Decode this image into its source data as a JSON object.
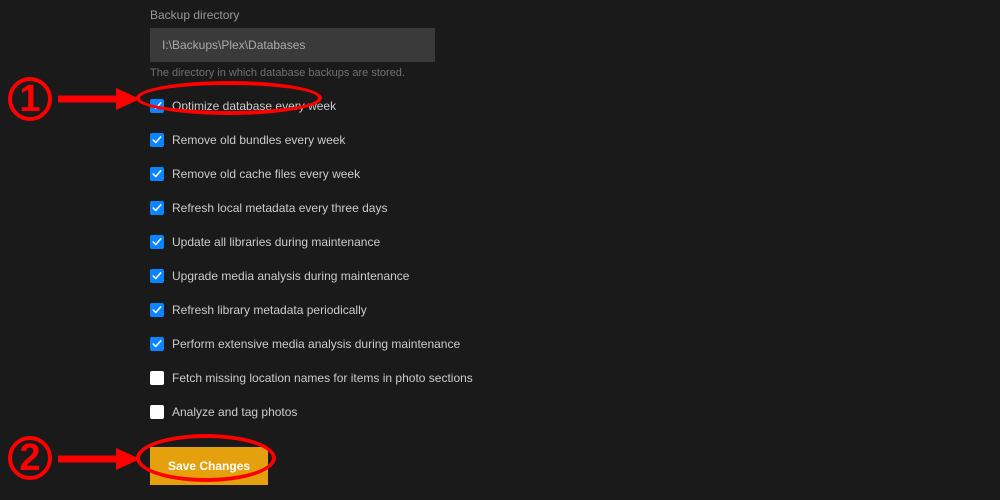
{
  "backup": {
    "label": "Backup directory",
    "value": "I:\\Backups\\Plex\\Databases",
    "help": "The directory in which database backups are stored."
  },
  "checkboxes": [
    {
      "label": "Optimize database every week",
      "checked": true
    },
    {
      "label": "Remove old bundles every week",
      "checked": true
    },
    {
      "label": "Remove old cache files every week",
      "checked": true
    },
    {
      "label": "Refresh local metadata every three days",
      "checked": true
    },
    {
      "label": "Update all libraries during maintenance",
      "checked": true
    },
    {
      "label": "Upgrade media analysis during maintenance",
      "checked": true
    },
    {
      "label": "Refresh library metadata periodically",
      "checked": true
    },
    {
      "label": "Perform extensive media analysis during maintenance",
      "checked": true
    },
    {
      "label": "Fetch missing location names for items in photo sections",
      "checked": false
    },
    {
      "label": "Analyze and tag photos",
      "checked": false
    }
  ],
  "save_button": "Save Changes",
  "annotations": {
    "step1": "1",
    "step2": "2"
  }
}
